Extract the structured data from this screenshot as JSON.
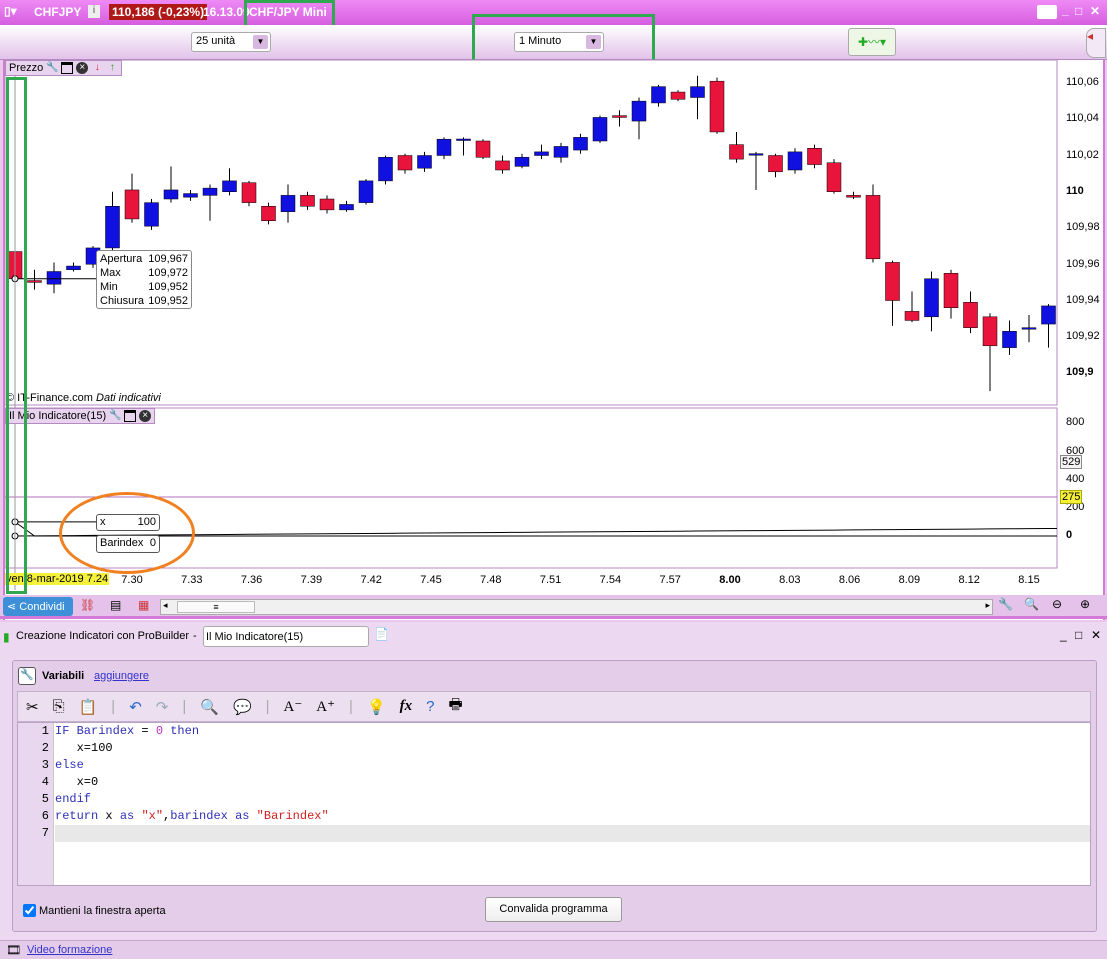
{
  "titlebar": {
    "symbol": "CHFJPY",
    "price_change": "110,186 (-0,23%)",
    "time": "16.13.09",
    "instrument": "CHF/JPY Mini"
  },
  "toolbar": {
    "units": "25 unità",
    "timeframe": "1 Minuto"
  },
  "price_panel": {
    "label": "Prezzo",
    "copyright": "© IT-Finance.com",
    "disclaimer": "Dati indicativi",
    "y_labels": [
      "110,06",
      "110,04",
      "110,02",
      "110",
      "109,98",
      "109,96",
      "109,94",
      "109,92",
      "109,9"
    ],
    "tooltip": {
      "rows": [
        [
          "Apertura",
          "109,967"
        ],
        [
          "Max",
          "109,972"
        ],
        [
          "Min",
          "109,952"
        ],
        [
          "Chiusura",
          "109,952"
        ]
      ]
    }
  },
  "indicator_panel": {
    "label": "Il Mio Indicatore(15)",
    "y_labels": [
      "800",
      "600",
      "400",
      "200",
      "0"
    ],
    "marker_high": "529",
    "marker_level": "275",
    "tooltip": {
      "rows": [
        [
          "x",
          "100"
        ],
        [
          "Barindex",
          "0"
        ]
      ]
    }
  },
  "time_axis": {
    "current": "ven 8-mar-2019 7.24",
    "labels": [
      "7.30",
      "7.33",
      "7.36",
      "7.39",
      "7.42",
      "7.45",
      "7.48",
      "7.51",
      "7.54",
      "7.57",
      "8.00",
      "8.03",
      "8.06",
      "8.09",
      "8.12",
      "8.15"
    ],
    "bold": "8.00"
  },
  "bottombar": {
    "share": "Condividi"
  },
  "colors": {
    "up": "#1010e0",
    "down": "#e8143c",
    "title": "#e070e8",
    "highlight": "#f5f03a",
    "annotation_green": "#2fa84f",
    "annotation_orange": "#f08020"
  },
  "chart_data": {
    "type": "candlestick",
    "title": "CHFJPY 1 Minuto",
    "ylim": [
      109.885,
      110.068
    ],
    "candles": [
      [
        109.967,
        109.972,
        109.952,
        109.952
      ],
      [
        109.951,
        109.957,
        109.946,
        109.95
      ],
      [
        109.949,
        109.961,
        109.944,
        109.956
      ],
      [
        109.957,
        109.961,
        109.956,
        109.959
      ],
      [
        109.96,
        109.97,
        109.958,
        109.969
      ],
      [
        109.969,
        110.0,
        109.966,
        109.992
      ],
      [
        110.001,
        110.01,
        109.983,
        109.985
      ],
      [
        109.981,
        109.996,
        109.979,
        109.994
      ],
      [
        109.996,
        110.014,
        109.994,
        110.001
      ],
      [
        109.997,
        110.001,
        109.995,
        109.999
      ],
      [
        109.998,
        110.004,
        109.984,
        110.002
      ],
      [
        110.0,
        110.013,
        109.998,
        110.006
      ],
      [
        110.005,
        110.006,
        109.992,
        109.994
      ],
      [
        109.992,
        109.994,
        109.982,
        109.984
      ],
      [
        109.989,
        110.004,
        109.983,
        109.998
      ],
      [
        109.998,
        110.0,
        109.99,
        109.992
      ],
      [
        109.996,
        109.998,
        109.988,
        109.99
      ],
      [
        109.99,
        109.995,
        109.989,
        109.993
      ],
      [
        109.994,
        110.007,
        109.993,
        110.006
      ],
      [
        110.006,
        110.02,
        110.004,
        110.019
      ],
      [
        110.02,
        110.021,
        110.01,
        110.012
      ],
      [
        110.013,
        110.022,
        110.011,
        110.02
      ],
      [
        110.02,
        110.03,
        110.018,
        110.029
      ],
      [
        110.029,
        110.03,
        110.02,
        110.0291
      ],
      [
        110.028,
        110.029,
        110.018,
        110.019
      ],
      [
        110.017,
        110.02,
        110.01,
        110.012
      ],
      [
        110.014,
        110.021,
        110.013,
        110.019
      ],
      [
        110.02,
        110.026,
        110.018,
        110.022
      ],
      [
        110.019,
        110.027,
        110.016,
        110.025
      ],
      [
        110.023,
        110.032,
        110.021,
        110.03
      ],
      [
        110.028,
        110.042,
        110.027,
        110.041
      ],
      [
        110.042,
        110.045,
        110.036,
        110.041
      ],
      [
        110.039,
        110.052,
        110.029,
        110.05
      ],
      [
        110.049,
        110.059,
        110.047,
        110.058
      ],
      [
        110.055,
        110.056,
        110.05,
        110.051
      ],
      [
        110.052,
        110.064,
        110.04,
        110.058
      ],
      [
        110.061,
        110.063,
        110.032,
        110.033
      ],
      [
        110.026,
        110.033,
        110.016,
        110.018
      ],
      [
        110.021,
        110.022,
        110.001,
        110.021
      ],
      [
        110.02,
        110.021,
        110.008,
        110.011
      ],
      [
        110.012,
        110.024,
        110.01,
        110.022
      ],
      [
        110.024,
        110.026,
        110.013,
        110.015
      ],
      [
        110.016,
        110.018,
        109.999,
        110.0
      ],
      [
        109.998,
        110.0,
        109.996,
        109.997
      ],
      [
        109.998,
        110.004,
        109.961,
        109.963
      ],
      [
        109.961,
        109.962,
        109.926,
        109.94
      ],
      [
        109.934,
        109.945,
        109.928,
        109.929
      ],
      [
        109.931,
        109.956,
        109.923,
        109.952
      ],
      [
        109.955,
        109.957,
        109.93,
        109.936
      ],
      [
        109.939,
        109.945,
        109.922,
        109.925
      ],
      [
        109.931,
        109.933,
        109.89,
        109.915
      ],
      [
        109.914,
        109.929,
        109.91,
        109.923
      ],
      [
        109.925,
        109.932,
        109.917,
        109.925
      ],
      [
        109.927,
        109.938,
        109.914,
        109.937
      ]
    ],
    "indicator": {
      "ylim": [
        -200,
        900
      ],
      "x_first": 100,
      "x_rest": 0,
      "barindex_start": 0
    }
  },
  "probuilder": {
    "title": "Creazione Indicatori con ProBuilder",
    "separator": "-",
    "indicator_name": "Il Mio Indicatore(15)",
    "variables": "Variabili",
    "add_link": "aggiungere",
    "code_lines": [
      "IF Barindex = 0 then",
      "   x=100",
      "else",
      "   x=0",
      "endif",
      "return x as \"x\",barindex as \"Barindex\"",
      ""
    ],
    "keep_open": "Mantieni la finestra aperta",
    "validate": "Convalida programma",
    "video": "Video formazione"
  }
}
